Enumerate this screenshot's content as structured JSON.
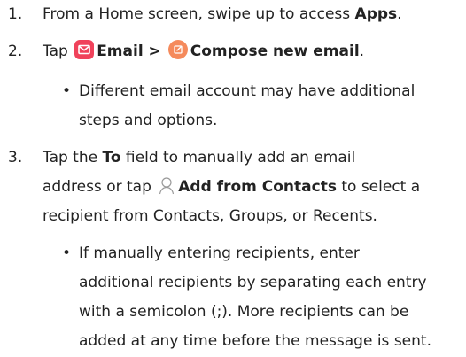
{
  "steps": [
    {
      "number": "1.",
      "text_before": "From a Home screen, swipe up to access ",
      "bold": "Apps",
      "text_after": "."
    },
    {
      "number": "2.",
      "tap": "Tap ",
      "email_label": "Email",
      "separator": " > ",
      "compose_label": "Compose new email",
      "end": ".",
      "icons": [
        "email-app-icon",
        "compose-icon"
      ],
      "bullet": {
        "line1": "Different email account may have additional",
        "line2": "steps and options."
      }
    },
    {
      "number": "3.",
      "line1_before": "Tap the ",
      "line1_bold": "To",
      "line1_after": " field to manually add an email",
      "line2_before": "address or tap ",
      "line2_bold": "Add from Contacts",
      "line2_after": " to select a",
      "line3": "recipient from Contacts, Groups, or Recents.",
      "icons": [
        "contact-icon"
      ],
      "bullet": {
        "line1": "If manually entering recipients, enter",
        "line2": "additional recipients by separating each entry",
        "line3": "with a semicolon (;). More recipients can be",
        "line4": "added at any time before the message is sent."
      }
    }
  ],
  "colors": {
    "text": "#222222",
    "email_icon": "#f0425b",
    "compose_icon": "#f58a5c"
  }
}
